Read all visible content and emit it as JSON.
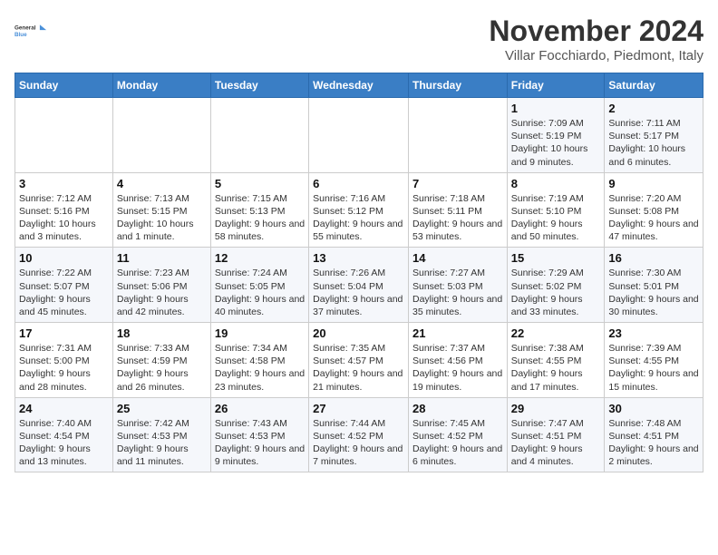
{
  "logo": {
    "line1": "General",
    "line2": "Blue"
  },
  "title": "November 2024",
  "subtitle": "Villar Focchiardo, Piedmont, Italy",
  "weekdays": [
    "Sunday",
    "Monday",
    "Tuesday",
    "Wednesday",
    "Thursday",
    "Friday",
    "Saturday"
  ],
  "weeks": [
    [
      {
        "day": "",
        "info": ""
      },
      {
        "day": "",
        "info": ""
      },
      {
        "day": "",
        "info": ""
      },
      {
        "day": "",
        "info": ""
      },
      {
        "day": "",
        "info": ""
      },
      {
        "day": "1",
        "info": "Sunrise: 7:09 AM\nSunset: 5:19 PM\nDaylight: 10 hours and 9 minutes."
      },
      {
        "day": "2",
        "info": "Sunrise: 7:11 AM\nSunset: 5:17 PM\nDaylight: 10 hours and 6 minutes."
      }
    ],
    [
      {
        "day": "3",
        "info": "Sunrise: 7:12 AM\nSunset: 5:16 PM\nDaylight: 10 hours and 3 minutes."
      },
      {
        "day": "4",
        "info": "Sunrise: 7:13 AM\nSunset: 5:15 PM\nDaylight: 10 hours and 1 minute."
      },
      {
        "day": "5",
        "info": "Sunrise: 7:15 AM\nSunset: 5:13 PM\nDaylight: 9 hours and 58 minutes."
      },
      {
        "day": "6",
        "info": "Sunrise: 7:16 AM\nSunset: 5:12 PM\nDaylight: 9 hours and 55 minutes."
      },
      {
        "day": "7",
        "info": "Sunrise: 7:18 AM\nSunset: 5:11 PM\nDaylight: 9 hours and 53 minutes."
      },
      {
        "day": "8",
        "info": "Sunrise: 7:19 AM\nSunset: 5:10 PM\nDaylight: 9 hours and 50 minutes."
      },
      {
        "day": "9",
        "info": "Sunrise: 7:20 AM\nSunset: 5:08 PM\nDaylight: 9 hours and 47 minutes."
      }
    ],
    [
      {
        "day": "10",
        "info": "Sunrise: 7:22 AM\nSunset: 5:07 PM\nDaylight: 9 hours and 45 minutes."
      },
      {
        "day": "11",
        "info": "Sunrise: 7:23 AM\nSunset: 5:06 PM\nDaylight: 9 hours and 42 minutes."
      },
      {
        "day": "12",
        "info": "Sunrise: 7:24 AM\nSunset: 5:05 PM\nDaylight: 9 hours and 40 minutes."
      },
      {
        "day": "13",
        "info": "Sunrise: 7:26 AM\nSunset: 5:04 PM\nDaylight: 9 hours and 37 minutes."
      },
      {
        "day": "14",
        "info": "Sunrise: 7:27 AM\nSunset: 5:03 PM\nDaylight: 9 hours and 35 minutes."
      },
      {
        "day": "15",
        "info": "Sunrise: 7:29 AM\nSunset: 5:02 PM\nDaylight: 9 hours and 33 minutes."
      },
      {
        "day": "16",
        "info": "Sunrise: 7:30 AM\nSunset: 5:01 PM\nDaylight: 9 hours and 30 minutes."
      }
    ],
    [
      {
        "day": "17",
        "info": "Sunrise: 7:31 AM\nSunset: 5:00 PM\nDaylight: 9 hours and 28 minutes."
      },
      {
        "day": "18",
        "info": "Sunrise: 7:33 AM\nSunset: 4:59 PM\nDaylight: 9 hours and 26 minutes."
      },
      {
        "day": "19",
        "info": "Sunrise: 7:34 AM\nSunset: 4:58 PM\nDaylight: 9 hours and 23 minutes."
      },
      {
        "day": "20",
        "info": "Sunrise: 7:35 AM\nSunset: 4:57 PM\nDaylight: 9 hours and 21 minutes."
      },
      {
        "day": "21",
        "info": "Sunrise: 7:37 AM\nSunset: 4:56 PM\nDaylight: 9 hours and 19 minutes."
      },
      {
        "day": "22",
        "info": "Sunrise: 7:38 AM\nSunset: 4:55 PM\nDaylight: 9 hours and 17 minutes."
      },
      {
        "day": "23",
        "info": "Sunrise: 7:39 AM\nSunset: 4:55 PM\nDaylight: 9 hours and 15 minutes."
      }
    ],
    [
      {
        "day": "24",
        "info": "Sunrise: 7:40 AM\nSunset: 4:54 PM\nDaylight: 9 hours and 13 minutes."
      },
      {
        "day": "25",
        "info": "Sunrise: 7:42 AM\nSunset: 4:53 PM\nDaylight: 9 hours and 11 minutes."
      },
      {
        "day": "26",
        "info": "Sunrise: 7:43 AM\nSunset: 4:53 PM\nDaylight: 9 hours and 9 minutes."
      },
      {
        "day": "27",
        "info": "Sunrise: 7:44 AM\nSunset: 4:52 PM\nDaylight: 9 hours and 7 minutes."
      },
      {
        "day": "28",
        "info": "Sunrise: 7:45 AM\nSunset: 4:52 PM\nDaylight: 9 hours and 6 minutes."
      },
      {
        "day": "29",
        "info": "Sunrise: 7:47 AM\nSunset: 4:51 PM\nDaylight: 9 hours and 4 minutes."
      },
      {
        "day": "30",
        "info": "Sunrise: 7:48 AM\nSunset: 4:51 PM\nDaylight: 9 hours and 2 minutes."
      }
    ]
  ]
}
